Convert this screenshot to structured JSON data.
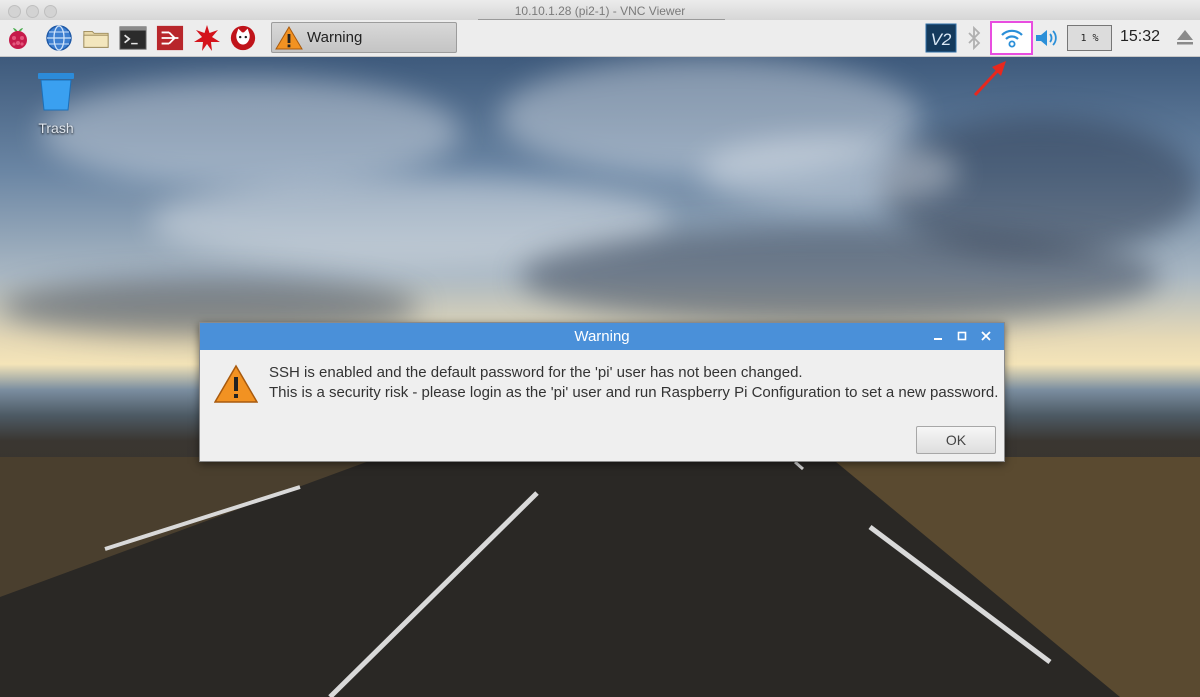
{
  "window": {
    "title": "10.10.1.28 (pi2-1) - VNC Viewer"
  },
  "panel": {
    "launchers": [
      "raspberry-menu-icon",
      "web-browser-icon",
      "file-manager-icon",
      "terminal-icon",
      "mathematica-icon",
      "wolfram-icon",
      "scratch-cat-icon"
    ],
    "task_button_label": "Warning",
    "tray": {
      "vnc_label": "V2",
      "cpu_usage": "1 %",
      "clock": "15:32"
    }
  },
  "desktop": {
    "trash_label": "Trash"
  },
  "dialog": {
    "title": "Warning",
    "message_line1": "SSH is enabled and the default password for the 'pi' user has not been changed.",
    "message_line2": "This is a security risk - please login as the 'pi' user and run Raspberry Pi Configuration to set a new password.",
    "ok_label": "OK"
  },
  "colors": {
    "dialog_title_bg": "#4a90d9",
    "highlight_box": "#e84de0",
    "annotation_arrow": "#e8281e"
  }
}
